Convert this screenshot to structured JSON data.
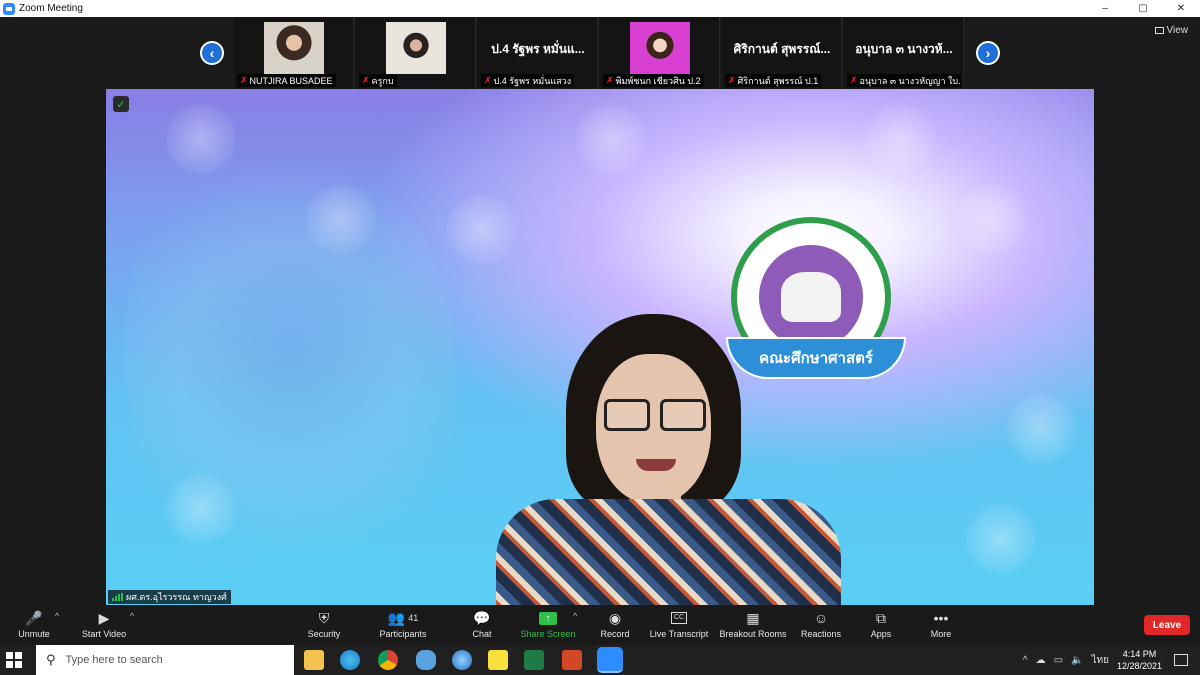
{
  "window": {
    "title": "Zoom Meeting",
    "controls": [
      "–",
      "▢",
      "✕"
    ]
  },
  "gallery": {
    "view_label": "View",
    "tiles": [
      {
        "display": "",
        "label": "NUTJIRA BUSADEE",
        "kind": "photo",
        "color": "#b08a70"
      },
      {
        "display": "",
        "label": "ครูกบ",
        "kind": "photo",
        "color": "#9d8f86"
      },
      {
        "display": "ป.4 รัฐพร หมั่นแ...",
        "label": "ป.4 รัฐพร หมั่นแสวง",
        "kind": "name"
      },
      {
        "display": "",
        "label": "พิมพ์ชนก เชียวศิน ป.2",
        "kind": "avatar",
        "color": "#d63fd0"
      },
      {
        "display": "ศิริกานต์ สุพรรณ์...",
        "label": "ศิริกานต์ สุพรรณ์ ป.1",
        "kind": "name"
      },
      {
        "display": "อนุบาล ๓ นางวห้...",
        "label": "อนุบาล ๓ นางวหัญญา ใบ...",
        "kind": "name"
      }
    ]
  },
  "main_video": {
    "speaker_label": "ผศ.ดร.อุไรวรรณ ทาญวงศ์",
    "emblem_ribbon": "คณะศึกษาศาสตร์"
  },
  "toolbar": {
    "unmute": "Unmute",
    "start_video": "Start Video",
    "security": "Security",
    "participants": "Participants",
    "participants_count": "41",
    "chat": "Chat",
    "share_screen": "Share Screen",
    "record": "Record",
    "live_transcript": "Live Transcript",
    "breakout_rooms": "Breakout Rooms",
    "reactions": "Reactions",
    "apps": "Apps",
    "more": "More",
    "leave": "Leave",
    "share_color": "#2fbf4a",
    "leave_color": "#e02828"
  },
  "taskbar": {
    "search_placeholder": "Type here to search",
    "time": "4:14 PM",
    "date": "12/28/2021",
    "lang": "ไทย",
    "apps": [
      "file-explorer",
      "edge",
      "chrome",
      "paint",
      "browser",
      "sticky-notes",
      "excel",
      "powerpoint",
      "zoom"
    ]
  }
}
